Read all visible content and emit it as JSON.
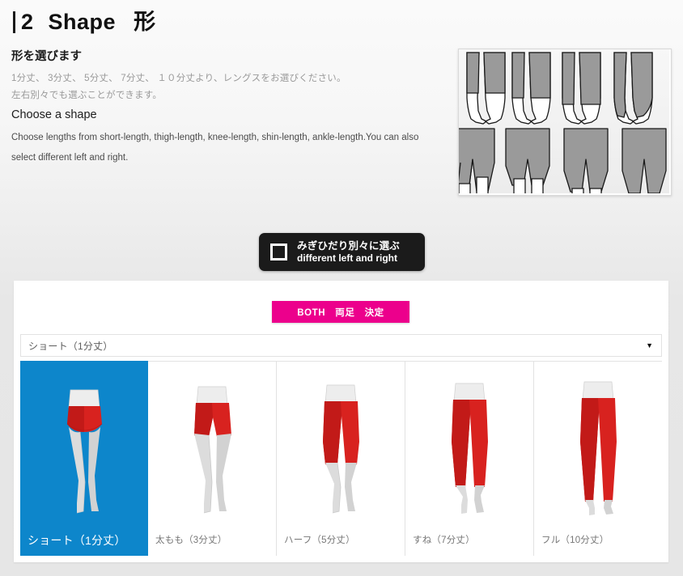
{
  "header": {
    "step_number": "2",
    "title_en": "Shape",
    "title_jp": "形"
  },
  "intro": {
    "heading_jp": "形を選びます",
    "desc_jp_1": "1分丈、 3分丈、 5分丈、 7分丈、 １０分丈より、レングスをお選びください。",
    "desc_jp_2": "左右別々でも選ぶことができます。",
    "heading_en": "Choose a shape",
    "desc_en": "Choose lengths from short-length, thigh-length, knee-length, shin-length, ankle-length.You can also select different left and right."
  },
  "illustration": {
    "alt": "leg-lengths-illustration"
  },
  "toggle": {
    "label_jp": "みぎひだり別々に選ぶ",
    "label_en": "different left and right",
    "checked": false
  },
  "panel": {
    "both_button_label": "BOTH　両足　決定",
    "select": {
      "value": "ショート（1分丈）",
      "arrow": "▼",
      "options": [
        "ショート（1分丈）",
        "太もも（3分丈）",
        "ハーフ（5分丈）",
        "すね（7分丈）",
        "フル（10分丈）"
      ]
    },
    "thumbnails": [
      {
        "label": "ショート（1分丈）",
        "length": 0.17,
        "selected": true
      },
      {
        "label": "太もも（3分丈）",
        "length": 0.3,
        "selected": false
      },
      {
        "label": "ハーフ（5分丈）",
        "length": 0.5,
        "selected": false
      },
      {
        "label": "すね（7分丈）",
        "length": 0.72,
        "selected": false
      },
      {
        "label": "フル（10分丈）",
        "length": 0.93,
        "selected": false
      }
    ]
  },
  "colors": {
    "accent_pink": "#ec008c",
    "selected_blue": "#0d86cb",
    "garment_red": "#d8221f",
    "page_bg": "#e6e6e6",
    "panel_bg": "#ffffff",
    "pill_bg": "#1b1b1b"
  }
}
